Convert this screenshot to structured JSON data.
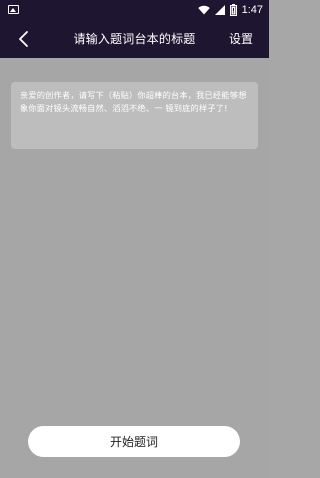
{
  "status_bar": {
    "time": "1:47",
    "icons": [
      "image-icon",
      "wifi-icon",
      "signal-icon",
      "battery-icon"
    ]
  },
  "app_bar": {
    "title": "请输入题词台本的标题",
    "settings_label": "设置",
    "back_icon": "chevron-left-icon"
  },
  "hint": {
    "text": "亲爱的创作者，请写下（粘贴）你超棒的台本，我已经能够想象你面对镜头流畅自然、滔滔不绝、一 镜到底的样子了!"
  },
  "action": {
    "start_label": "开始题词"
  },
  "colors": {
    "header_bg": "#1e1630",
    "content_bg": "#a6a6a6",
    "hint_bg": "#bdbdbd",
    "button_bg": "#ffffff"
  }
}
